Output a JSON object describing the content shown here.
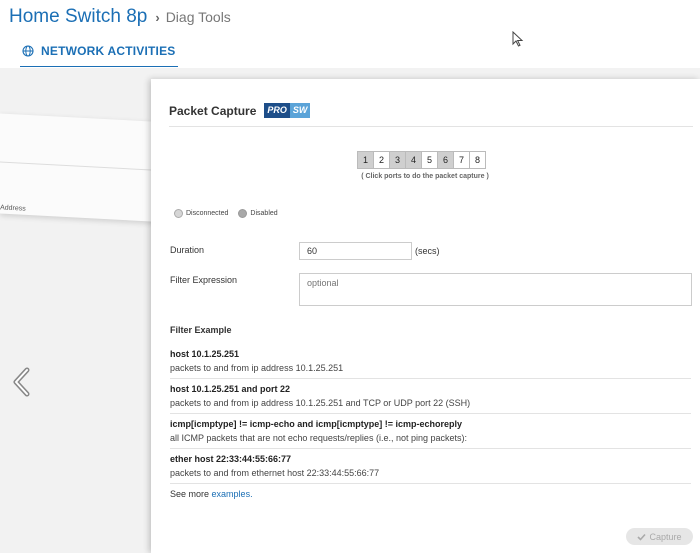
{
  "header": {
    "breadcrumb_main": "Home Switch 8p",
    "breadcrumb_sub": "Diag Tools"
  },
  "tab": {
    "label": "NETWORK ACTIVITIES",
    "icon": "globe-icon"
  },
  "background": {
    "ghost_label": "Address"
  },
  "panel": {
    "title": "Packet Capture",
    "badge_left": "PRO",
    "badge_right": "SW",
    "ports": [
      {
        "label": "1",
        "disabled": true
      },
      {
        "label": "2",
        "disabled": false
      },
      {
        "label": "3",
        "disabled": true
      },
      {
        "label": "4",
        "disabled": true
      },
      {
        "label": "5",
        "disabled": false
      },
      {
        "label": "6",
        "disabled": true
      },
      {
        "label": "7",
        "disabled": false
      },
      {
        "label": "8",
        "disabled": false
      }
    ],
    "ports_hint": "( Click ports to do the packet capture )",
    "legend": {
      "disconnected": "Disconnected",
      "disabled": "Disabled"
    },
    "duration": {
      "label": "Duration",
      "value": "60",
      "unit": "(secs)"
    },
    "filter": {
      "label": "Filter Expression",
      "placeholder": "optional"
    },
    "examples_title": "Filter Example",
    "examples": [
      {
        "cmd": "host 10.1.25.251",
        "desc": "packets to and from ip address 10.1.25.251"
      },
      {
        "cmd": "host 10.1.25.251 and port 22",
        "desc": "packets to and from ip address 10.1.25.251 and TCP or UDP port 22 (SSH)"
      },
      {
        "cmd": "icmp[icmptype] != icmp-echo and icmp[icmptype] != icmp-echoreply",
        "desc": "all ICMP packets that are not echo requests/replies (i.e., not ping packets):"
      },
      {
        "cmd": "ether host 22:33:44:55:66:77",
        "desc": "packets to and from ethernet host 22:33:44:55:66:77"
      }
    ],
    "see_more_prefix": "See more",
    "see_more_link": "examples.",
    "capture_button": "Capture"
  },
  "colors": {
    "accent": "#1b6fb5",
    "badge_dark": "#1d4e89",
    "badge_light": "#5aa3d8"
  }
}
